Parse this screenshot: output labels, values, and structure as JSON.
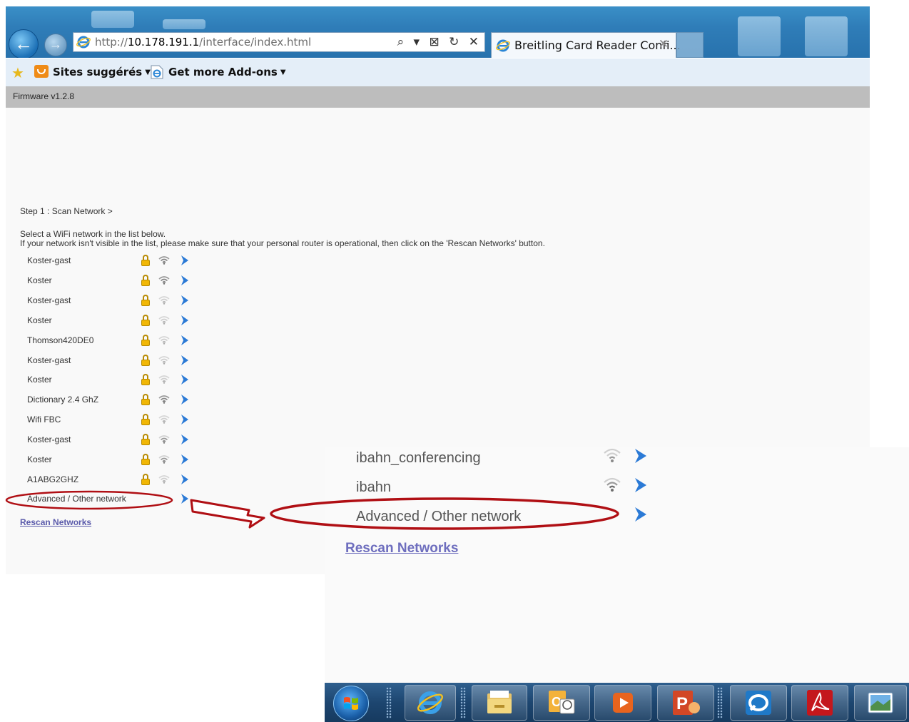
{
  "browser": {
    "url_prefix": "http://",
    "url_host": "10.178.191.1",
    "url_path": "/interface/index.html",
    "addr_tools": "⌕ ▾ ⊠ ↻ ✕",
    "tab_title": "Breitling Card Reader Confi...",
    "tab_close": "✕"
  },
  "favorites": {
    "sites_label": "Sites suggérés",
    "addons_label": "Get more Add-ons",
    "caret": "▼"
  },
  "page": {
    "firmware": "Firmware v1.2.8",
    "step": "Step 1 : Scan Network >",
    "instruction_1": "Select a WiFi network in the list below.",
    "instruction_2": "If your network isn't visible in the list, please make sure that your personal router is operational, then click on the 'Rescan Networks' button.",
    "networks": [
      {
        "name": "Koster-gast",
        "signal": "strong"
      },
      {
        "name": "Koster",
        "signal": "strong"
      },
      {
        "name": "Koster-gast",
        "signal": "weak"
      },
      {
        "name": "Koster",
        "signal": "weak"
      },
      {
        "name": "Thomson420DE0",
        "signal": "weak"
      },
      {
        "name": "Koster-gast",
        "signal": "weak"
      },
      {
        "name": "Koster",
        "signal": "weak"
      },
      {
        "name": "Dictionary 2.4 GhZ",
        "signal": "strong"
      },
      {
        "name": "Wifi FBC",
        "signal": "weak"
      },
      {
        "name": "Koster-gast",
        "signal": "medium"
      },
      {
        "name": "Koster",
        "signal": "medium"
      },
      {
        "name": "A1ABG2GHZ",
        "signal": "weak"
      }
    ],
    "advanced": "Advanced / Other network",
    "rescan": "Rescan Networks"
  },
  "inset": {
    "networks": [
      {
        "name": "ibahn_conferencing",
        "signal": "weak"
      },
      {
        "name": "ibahn",
        "signal": "medium"
      }
    ],
    "advanced": "Advanced / Other network",
    "rescan": "Rescan Networks"
  },
  "colors": {
    "annotation_red": "#b00f14",
    "chevron_blue": "#2b7ad6",
    "link_purple": "#6e6ebe",
    "lock_gold": "#f1b705"
  },
  "taskbar": {
    "icons": [
      "windows-start-icon",
      "internet-explorer-icon",
      "file-explorer-icon",
      "outlook-icon",
      "media-player-icon",
      "powerpoint-icon",
      "lync-icon",
      "acrobat-icon",
      "picture-viewer-icon"
    ]
  }
}
